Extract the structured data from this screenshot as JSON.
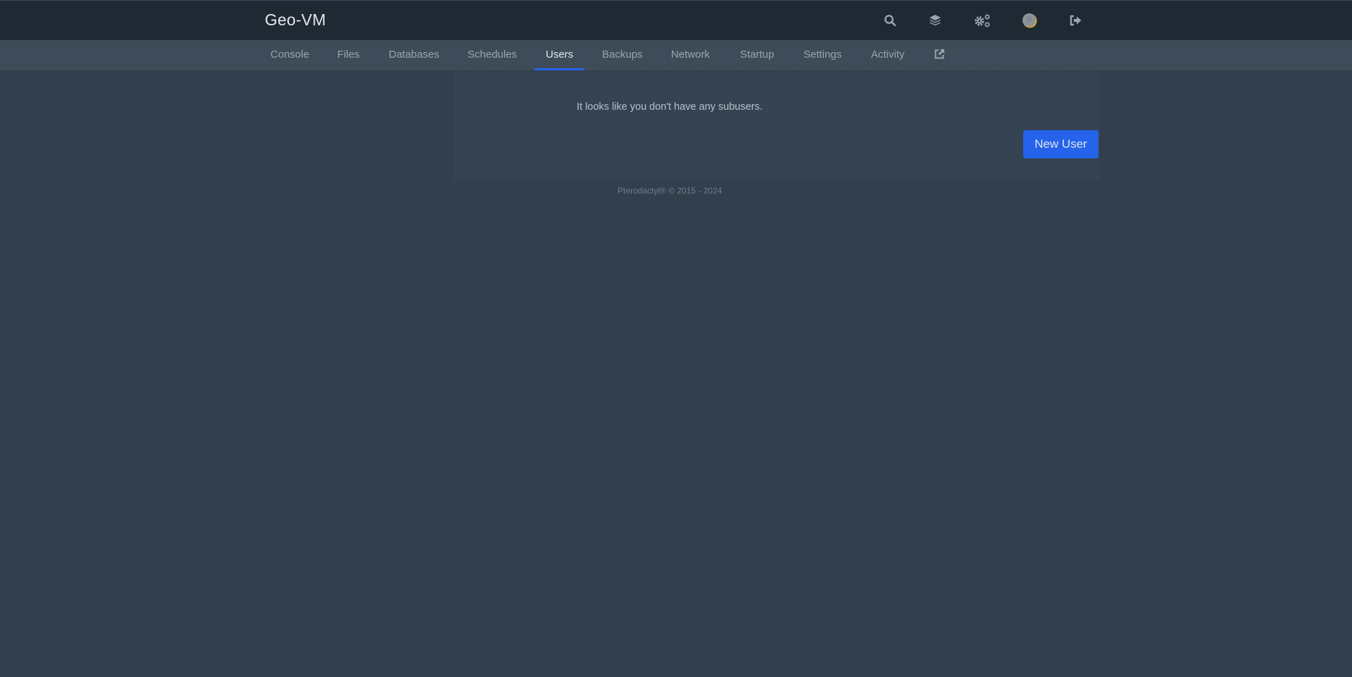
{
  "header": {
    "title": "Geo-VM",
    "icons": [
      "search-icon",
      "layers-icon",
      "cogs-icon",
      "avatar",
      "sign-out-icon"
    ]
  },
  "nav": {
    "tabs": [
      {
        "label": "Console",
        "active": false
      },
      {
        "label": "Files",
        "active": false
      },
      {
        "label": "Databases",
        "active": false
      },
      {
        "label": "Schedules",
        "active": false
      },
      {
        "label": "Users",
        "active": true
      },
      {
        "label": "Backups",
        "active": false
      },
      {
        "label": "Network",
        "active": false
      },
      {
        "label": "Startup",
        "active": false
      },
      {
        "label": "Settings",
        "active": false
      },
      {
        "label": "Activity",
        "active": false
      }
    ],
    "external_link_icon": "external-link-icon"
  },
  "main": {
    "empty_message": "It looks like you don't have any subusers.",
    "new_user_label": "New User"
  },
  "footer": {
    "text": "Pterodactyl® © 2015 - 2024"
  },
  "colors": {
    "accent": "#2563eb",
    "topbar": "#1f2933",
    "navbar": "#3e4c59",
    "background": "#333f4d"
  }
}
